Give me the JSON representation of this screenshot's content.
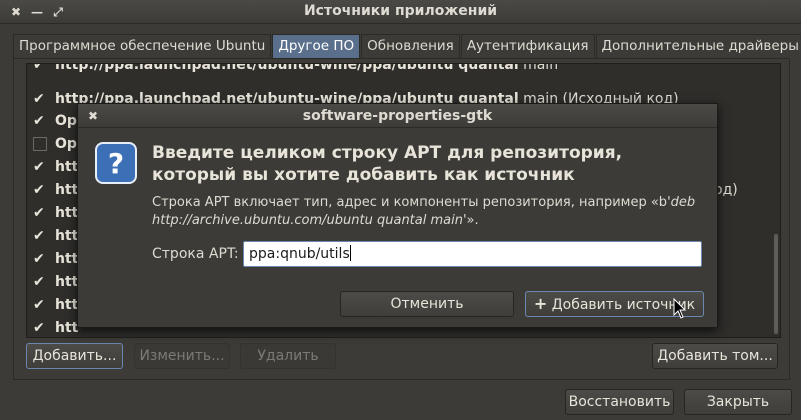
{
  "window": {
    "title": "Источники приложений",
    "close_glyph": "✖",
    "minimize_glyph": "—",
    "maximize_glyph": "⤢"
  },
  "tabs": [
    {
      "label": "Программное обеспечение Ubuntu",
      "active": false
    },
    {
      "label": "Другое ПО",
      "active": true
    },
    {
      "label": "Обновления",
      "active": false
    },
    {
      "label": "Аутентификация",
      "active": false
    },
    {
      "label": "Дополнительные драйверы",
      "active": false
    }
  ],
  "sources": [
    {
      "checked": true,
      "url": "http://ppa.launchpad.net/ubuntu-wine/ppa/ubuntu quantal",
      "rest": " main"
    },
    {
      "checked": true,
      "url": "http://ppa.launchpad.net/ubuntu-wine/ppa/ubuntu quantal",
      "rest": " main (Исходный код)"
    },
    {
      "checked": true,
      "url": "Ope",
      "rest": ""
    },
    {
      "checked": false,
      "url": "Ope",
      "rest": ""
    },
    {
      "checked": true,
      "url": "htt",
      "rest": ""
    },
    {
      "checked": true,
      "url": "htt",
      "rest": "од)"
    },
    {
      "checked": true,
      "url": "htt",
      "rest": ""
    },
    {
      "checked": true,
      "url": "htt",
      "rest": ""
    },
    {
      "checked": true,
      "url": "htt",
      "rest": ""
    },
    {
      "checked": true,
      "url": "htt",
      "rest": ""
    },
    {
      "checked": true,
      "url": "htt",
      "rest": ""
    },
    {
      "checked": true,
      "url": "htt",
      "rest": ""
    }
  ],
  "buttons": {
    "add": "Добавить...",
    "edit": "Изменить...",
    "remove": "Удалить",
    "add_volume": "Добавить том...",
    "revert": "Восстановить",
    "close": "Закрыть"
  },
  "dialog": {
    "title": "software-properties-gtk",
    "heading": "Введите целиком строку APT для репозитория, который вы хотите добавить как источник",
    "desc_prefix": "Строка APT включает тип, адрес и компоненты репозитория, например «b",
    "desc_example": "'deb http://archive.ubuntu.com/ubuntu quantal main'",
    "desc_suffix": "».",
    "apt_label": "Строка APT:",
    "apt_value": "ppa:qnub/utils",
    "cancel": "Отменить",
    "add_source": "Добавить источник",
    "add_source_icon": "plus-icon"
  },
  "colors": {
    "active_tab": "#5a6f8c",
    "dialog_bg": "#3c3b37",
    "question_icon": "#3b6fb6"
  }
}
